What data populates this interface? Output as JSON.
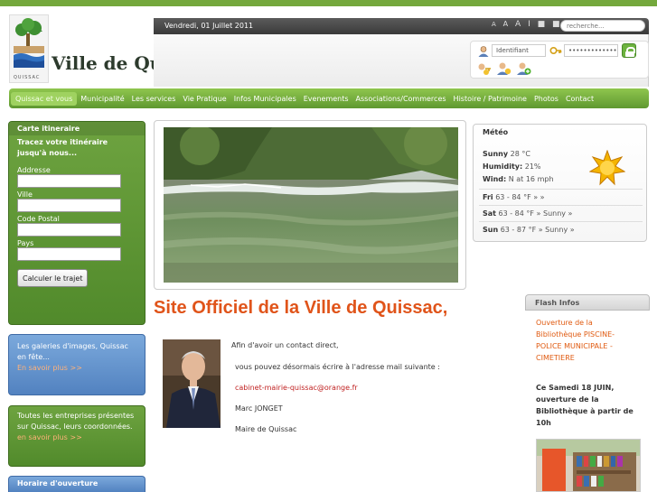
{
  "header": {
    "date": "Vendredi, 01 Juillet 2011",
    "font_sizes": [
      "A",
      "A",
      "A",
      "I",
      "■",
      "■"
    ],
    "search_placeholder": "recherche...",
    "site_title": "Ville de Quissac",
    "logo_caption": "QUISSAC"
  },
  "login": {
    "username_value": "Identifiant",
    "password_value": "•••••••••••••"
  },
  "nav": {
    "items": [
      "Quissac et vous",
      "Municipalité",
      "Les services",
      "Vie Pratique",
      "Infos Municipales",
      "Evenements",
      "Associations/Commerces",
      "Histoire / Patrimoine",
      "Photos",
      "Contact"
    ]
  },
  "sidebar": {
    "itinerary": {
      "title": "Carte itineraire",
      "subtitle": "Tracez votre itinéraire jusqu'à nous...",
      "fields": [
        "Addresse",
        "Ville",
        "Code Postal",
        "Pays"
      ],
      "button": "Calculer le trajet"
    },
    "gallery": {
      "text": "Les galeries d'images, Quissac en fête...",
      "link": "En savoir plus >>"
    },
    "businesses": {
      "text": "Toutes les entreprises présentes sur Quissac, leurs coordonnées.",
      "link": "en savoir plus >>"
    },
    "hours": {
      "title": "Horaire d'ouverture"
    }
  },
  "main": {
    "title": "Site Officiel de la Ville de Quissac,",
    "contact": {
      "line1": "Afin d'avoir un contact direct,",
      "line2": "vous pouvez désormais écrire à l'adresse mail  suivante :",
      "email": "cabinet-mairie-quissac@orange.fr",
      "name": "Marc JONGET",
      "role": "Maire de Quissac"
    }
  },
  "weather": {
    "title": "Météo",
    "now_label": "Sunny",
    "now_temp": "28 °C",
    "humidity_label": "Humidity:",
    "humidity": "21%",
    "wind_label": "Wind:",
    "wind": "N at 16 mph",
    "forecast": [
      {
        "day": "Fri",
        "range": "63 - 84 °F »  »"
      },
      {
        "day": "Sat",
        "range": "63 - 84 °F » Sunny »"
      },
      {
        "day": "Sun",
        "range": "63 - 87 °F » Sunny »"
      }
    ]
  },
  "flash": {
    "title": "Flash Infos",
    "link": "Ouverture de la Bibliothèque PISCINE-POLICE MUNICIPALE - CIMETIERE",
    "text": "Ce Samedi 18 JUIN, ouverture de la Bibliothèque à partir de 10h"
  },
  "colors": {
    "accent_green": "#74a83c",
    "title_orange": "#e0541a",
    "panel_blue": "#5282c0"
  }
}
